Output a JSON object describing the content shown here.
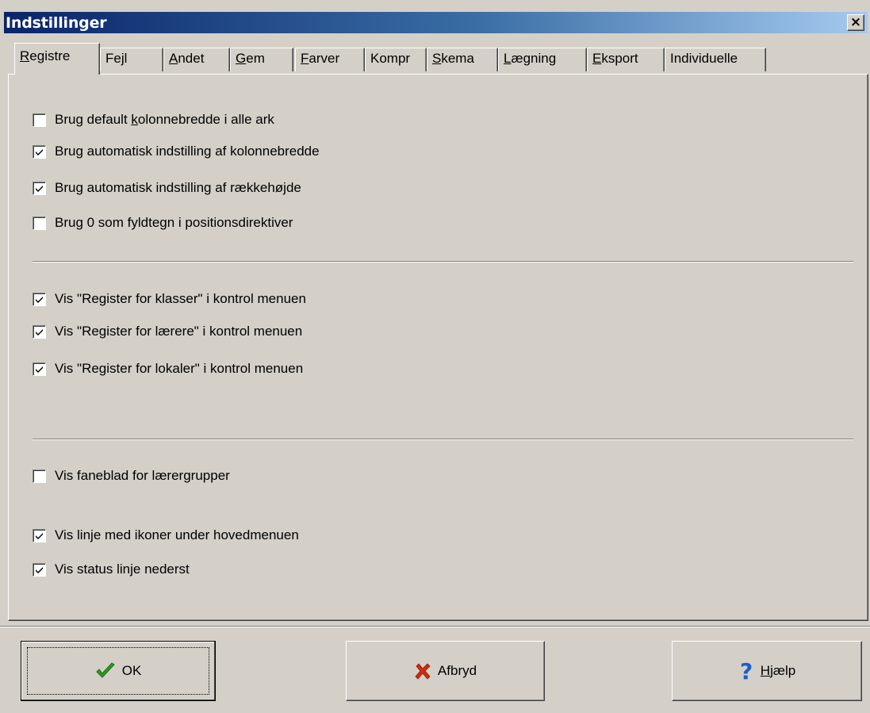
{
  "window": {
    "title": "Indstillinger",
    "close_label": "×"
  },
  "tabs": [
    {
      "label": "Registre",
      "ul": 0,
      "active": true
    },
    {
      "label": "Fejl",
      "ul": 2
    },
    {
      "label": "Andet",
      "ul": 0
    },
    {
      "label": "Gem",
      "ul": 0
    },
    {
      "label": "Farver",
      "ul": 0
    },
    {
      "label": "Kompr",
      "ul": -1
    },
    {
      "label": "Skema",
      "ul": 0
    },
    {
      "label": "Lægning",
      "ul": 0
    },
    {
      "label": "Eksport",
      "ul": 0
    },
    {
      "label": "Individuelle",
      "ul": -1
    }
  ],
  "group1": [
    {
      "label_pre": "Brug default ",
      "label_ul": "k",
      "label_post": "olonnebredde i alle ark",
      "checked": false
    },
    {
      "label_pre": "Brug automatisk indstilling af kolonnebredde",
      "label_ul": "",
      "label_post": "",
      "checked": true
    },
    {
      "label_pre": "Brug automatisk indstilling af rækkehøjde",
      "label_ul": "",
      "label_post": "",
      "checked": true
    },
    {
      "label_pre": "Brug 0 som fyldtegn i positionsdirektiver",
      "label_ul": "",
      "label_post": "",
      "checked": false
    }
  ],
  "group2": [
    {
      "label": "Vis \"Register for klasser\" i kontrol menuen",
      "checked": true
    },
    {
      "label": "Vis \"Register for lærere\" i kontrol menuen",
      "checked": true
    },
    {
      "label": "Vis \"Register for lokaler\" i kontrol menuen",
      "checked": true
    }
  ],
  "group3": [
    {
      "label": "Vis faneblad for lærergrupper",
      "checked": false
    },
    {
      "label": "Vis linje med ikoner under hovedmenuen",
      "checked": true
    },
    {
      "label": "Vis status linje nederst",
      "checked": true
    }
  ],
  "buttons": {
    "ok": "OK",
    "cancel": "Afbryd",
    "help_ul": "H",
    "help_rest": "jælp"
  },
  "colors": {
    "title_start": "#0a246a",
    "title_end": "#a6caf0",
    "ok_icon": "#2e9a1e",
    "cancel_icon": "#d22a10",
    "help_icon": "#1a5fd0"
  }
}
